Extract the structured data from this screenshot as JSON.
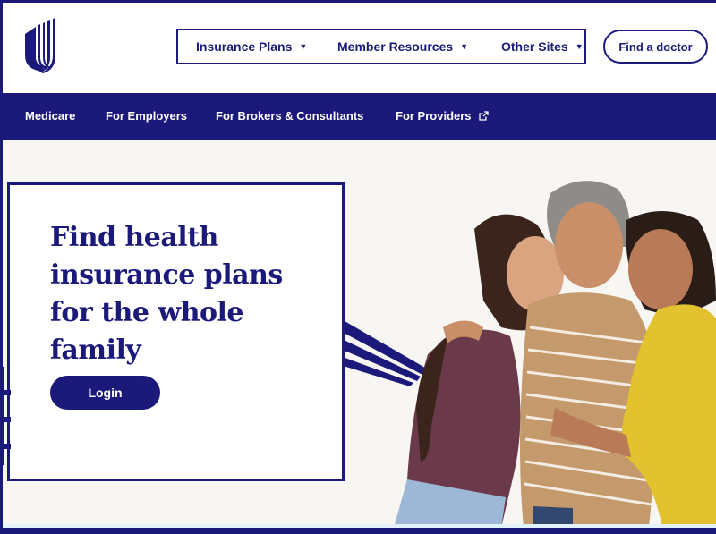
{
  "brand": {
    "logo_icon": "unitedhealthcare-u-logo",
    "primary_color": "#1b1a7a",
    "background_color": "#f8f6f3"
  },
  "header": {
    "nav": [
      {
        "label": "Insurance Plans",
        "icon": "caret-down-icon"
      },
      {
        "label": "Member Resources",
        "icon": "caret-down-icon"
      },
      {
        "label": "Other Sites",
        "icon": "caret-down-icon"
      }
    ],
    "find_doctor_label": "Find a doctor"
  },
  "subnav": {
    "items": [
      {
        "label": "Medicare"
      },
      {
        "label": "For Employers"
      },
      {
        "label": "For Brokers & Consultants"
      },
      {
        "label": "For Providers",
        "icon": "external-link-icon"
      }
    ]
  },
  "hero": {
    "headline_lines": [
      "Find health",
      "insurance plans",
      "for the whole",
      "family"
    ],
    "login_label": "Login",
    "photo_alt": "Three smiling women hugging"
  }
}
